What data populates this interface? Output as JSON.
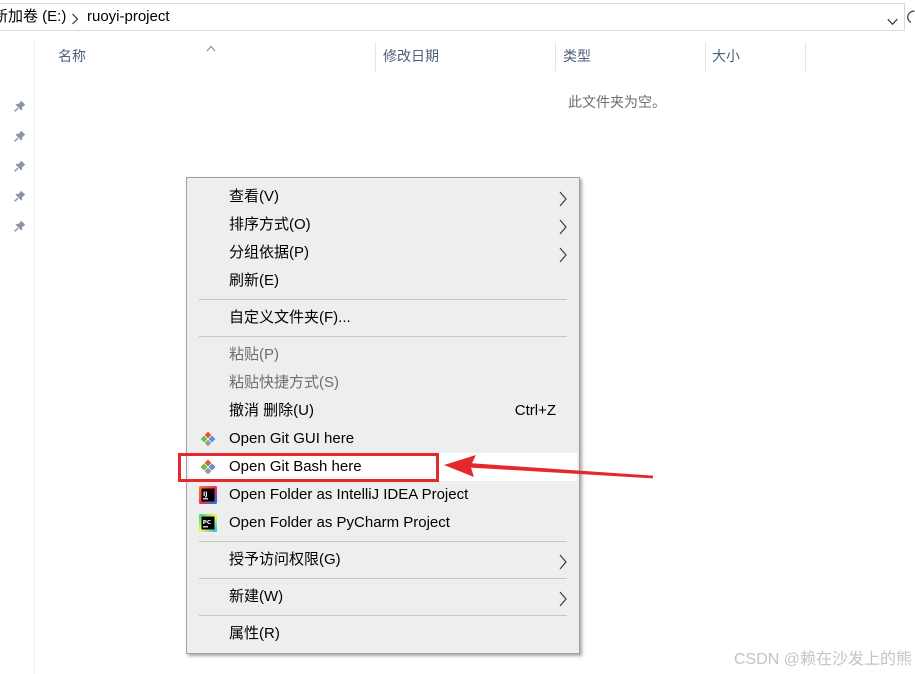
{
  "window": {
    "address_bar": {
      "drive_label": "新加卷 (E:)",
      "folder_label": "ruoyi-project",
      "separator_icon": "chevron-right-icon",
      "dropdown_icon": "chevron-down-icon",
      "refresh_icon": "refresh-icon"
    },
    "quick_access_pins": [
      "pin-icon",
      "pin-icon",
      "pin-icon",
      "pin-icon",
      "pin-icon"
    ],
    "columns": [
      {
        "label": "名称",
        "sort_icon": "sort-ascending-icon"
      },
      {
        "label": "修改日期"
      },
      {
        "label": "类型"
      },
      {
        "label": "大小"
      }
    ],
    "empty_message": "此文件夹为空。"
  },
  "context_menu": {
    "items": [
      {
        "label": "查看(V)",
        "submenu": true
      },
      {
        "label": "排序方式(O)",
        "submenu": true
      },
      {
        "label": "分组依据(P)",
        "submenu": true
      },
      {
        "label": "刷新(E)"
      },
      {
        "label": "自定义文件夹(F)..."
      },
      {
        "label": "粘贴(P)",
        "disabled": true
      },
      {
        "label": "粘贴快捷方式(S)",
        "disabled": true
      },
      {
        "label": "撤消 删除(U)",
        "shortcut": "Ctrl+Z"
      },
      {
        "label": "Open Git GUI here",
        "icon": "git-icon"
      },
      {
        "label": "Open Git Bash here",
        "icon": "git-icon",
        "highlighted": true
      },
      {
        "label": "Open Folder as IntelliJ IDEA Project",
        "icon": "intellij-idea-icon",
        "logo_text": "IJ"
      },
      {
        "label": "Open Folder as PyCharm Project",
        "icon": "pycharm-icon",
        "logo_text": "PC"
      },
      {
        "label": "授予访问权限(G)",
        "submenu": true
      },
      {
        "label": "新建(W)",
        "submenu": true
      },
      {
        "label": "属性(R)"
      }
    ]
  },
  "watermark": "CSDN @赖在沙发上的熊",
  "colors": {
    "menu_background": "#eeeeee",
    "menu_border": "#a0a0a0",
    "highlight_row": "#ffffff",
    "disabled_text": "#6d6d6d",
    "column_header_text": "#4c607a",
    "annotation_red": "#e4282c",
    "watermark_text": "#c4c4c4"
  }
}
